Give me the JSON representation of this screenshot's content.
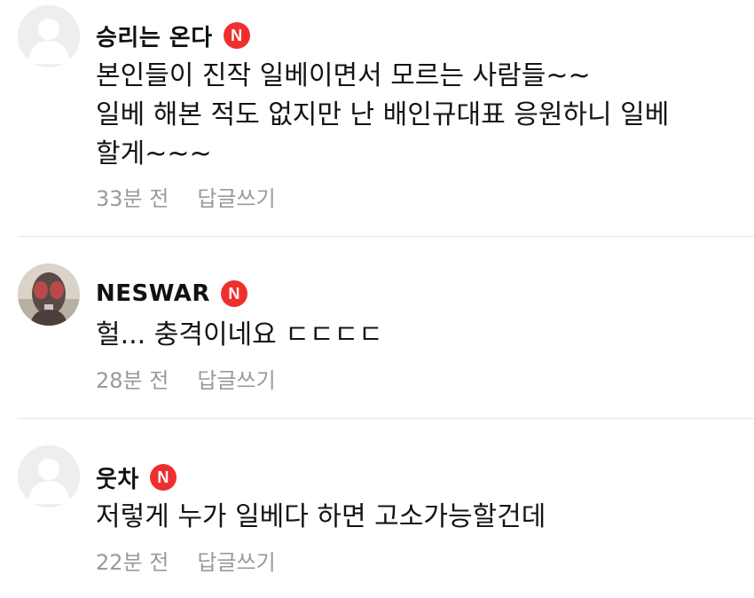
{
  "badge_letter": "N",
  "colors": {
    "badge": "#ef2f2f",
    "meta_text": "#9a9a9a",
    "divider": "#e6e6e6"
  },
  "comments": [
    {
      "username": "승리는 온다",
      "avatar": "default-avatar",
      "lines": [
        "본인들이 진작 일베이면서 모르는 사람들~~",
        "일베 해본 적도 없지만 난 배인규대표 응원하니 일베",
        "할게~~~"
      ],
      "time": "33분 전",
      "reply_label": "답글쓰기"
    },
    {
      "username": "NESWAR",
      "avatar": "masked-hero-avatar",
      "lines": [
        "헐... 충격이네요 ㄷㄷㄷㄷ"
      ],
      "time": "28분 전",
      "reply_label": "답글쓰기"
    },
    {
      "username": "웃차",
      "avatar": "default-avatar",
      "lines": [
        "저렇게 누가 일베다 하면 고소가능할건데"
      ],
      "time": "22분 전",
      "reply_label": "답글쓰기"
    }
  ]
}
